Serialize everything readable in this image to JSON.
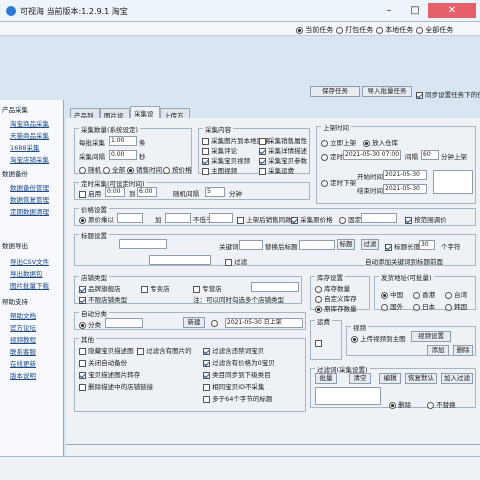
{
  "titlebar": {
    "title": "可视海 当前版本:1.2.9.1 淘宝"
  },
  "toolbar": {
    "radio_1": "当前任务",
    "radio_2": "打包任务",
    "radio_3": "本地任务",
    "radio_4": "全部任务"
  },
  "buttons": {
    "save_task": "保存任务",
    "import_batch": "导入批量任务",
    "check_label": "同步设置任务下的任务"
  },
  "tabs": [
    "产品列表",
    "图片设置",
    "采集设置",
    "上传方式"
  ],
  "sidebar": {
    "groups": [
      "产品采集",
      "数据备份",
      "数据导出",
      "帮助支持"
    ],
    "items": [
      "淘宝商品采集",
      "天猫商品采集",
      "1688采集",
      "淘宝店铺采集",
      "数据备份管理",
      "数据恢复管理",
      "定期数据清理",
      "导出CSV文件",
      "导出数据包",
      "图片批量下载",
      "帮助文档",
      "官方论坛",
      "视频教程",
      "联系客服",
      "在线更新",
      "版本说明"
    ]
  },
  "collect": {
    "label": "采集数量(系统设定)",
    "count_label": "每批采集",
    "count_value": "1.00",
    "unit": "条",
    "delay_label": "采集间隔",
    "delay_value": "0.00",
    "sec": "秒",
    "opt1": "随机",
    "opt2": "全部",
    "opt3": "销售时间",
    "opt4": "按价格"
  },
  "content_opts": {
    "label": "采集内容",
    "c1": "采集图片到本地目录",
    "c2": "采集销售属性",
    "c3": "采集评论",
    "c4": "采集详情描述",
    "c5": "采集宝贝视频",
    "c6": "采集宝贝参数",
    "c7": "采集SKU图片",
    "c8": "主图视频",
    "c9": "采集运费",
    "c10": "采集属性图片"
  },
  "upload_mode": {
    "label": "上架时间",
    "o1": "立即上架",
    "o2": "放入仓库",
    "o3": "定时上架",
    "date1": "2021-05-30 07:00",
    "interval": "间隔",
    "interval_value": "60",
    "interval_unit": "分钟上架",
    "o4": "定时下架",
    "start_label": "开始时间",
    "start_value": "2021-05-30",
    "end_label": "结束时间",
    "end_value": "2021-05-30"
  },
  "schedule": {
    "label": "定时采集(可设定时间)",
    "enable": "启用",
    "start": "0:00",
    "to": "到",
    "end": "6:00",
    "random_label": "随机间隔",
    "random_value": "5",
    "unit": "分钟"
  },
  "price": {
    "label": "价格设置",
    "rate_label": "原价",
    "multiply": "乘以",
    "add_label": "加",
    "fixed": "不低于",
    "check_a": "上架后销售同款",
    "check_b": "采集原价格",
    "opt_other": "固定",
    "check_c": "按范围调价"
  },
  "title_opts": {
    "label": "标题设置",
    "prefix_label": "前缀",
    "suffix_label": "替换后标题",
    "replace": "替换",
    "filter": "过滤",
    "keyword_label": "关键词",
    "keyword_value": "",
    "limit_label": "标题长度",
    "limit_value": "30",
    "chars": "个字符",
    "btn1": "标题",
    "btn2": "过滤",
    "note": "自动添加关键词到标题前面"
  },
  "store": {
    "label": "店铺类型",
    "c1": "品牌旗舰店",
    "c2": "专卖店",
    "c3": "专营店",
    "value": "",
    "c4": "不限店铺类型",
    "note": "注：可以同时勾选多个店铺类型"
  },
  "stock": {
    "label": "库存设置",
    "o1": "库存数量",
    "o2": "自定义库存",
    "o3": "原库存数量"
  },
  "ship": {
    "label": "发货地址(可批量)",
    "o1": "中国",
    "o2": "香港",
    "o3": "台湾",
    "o4": "国外",
    "o5": "日本",
    "o6": "韩国"
  },
  "auto": {
    "label": "自动分类",
    "o1": "分类",
    "placeholder": "",
    "btn": "新建",
    "o2": "新增类目,并添加宝贝到店铺",
    "value": "2021-05-30 日上架"
  },
  "other": {
    "label": "其他",
    "c1": "隐藏宝贝描述图",
    "c2": "过滤含有图片的",
    "c3": "过滤含违禁词宝贝",
    "c4": "大批量采集",
    "c5": "关闭自动备份",
    "c6": "转换宝贝标题",
    "c7": "宝贝描述图片转存",
    "c8": "编辑标题",
    "c9": "同步到类目",
    "c10": "同步分类并下架",
    "c11": "过滤含有价格为0宝贝",
    "c12": "类目同步到下级类目",
    "c13": "同步标题",
    "c14": "同步到",
    "c15": "删除描述中的店铺链接",
    "c16": "删除多余属性",
    "c17": "多于64个字节的标题",
    "c18": "相同宝贝ID不采集",
    "c19": "删除首图",
    "c20": "不采集的产品"
  },
  "watermark": {
    "label": "视频",
    "o1": "上传视频到主图",
    "btn1": "视频设置",
    "btn2": "添加",
    "btn3": "删除",
    "o2": "放大",
    "o3": "缩小"
  },
  "shipping": {
    "label": "运费",
    "o1": "模板设置",
    "o2": "指定",
    "btn": "设置",
    "o3": "选择模板"
  },
  "filter": {
    "label": "过滤词(采集设置)",
    "btn1": "批量",
    "btn2": "清空",
    "btn3": "编辑",
    "btn4": "恢复默认",
    "btn5": "加入过滤",
    "o1": "删除",
    "o2": "不替换"
  }
}
